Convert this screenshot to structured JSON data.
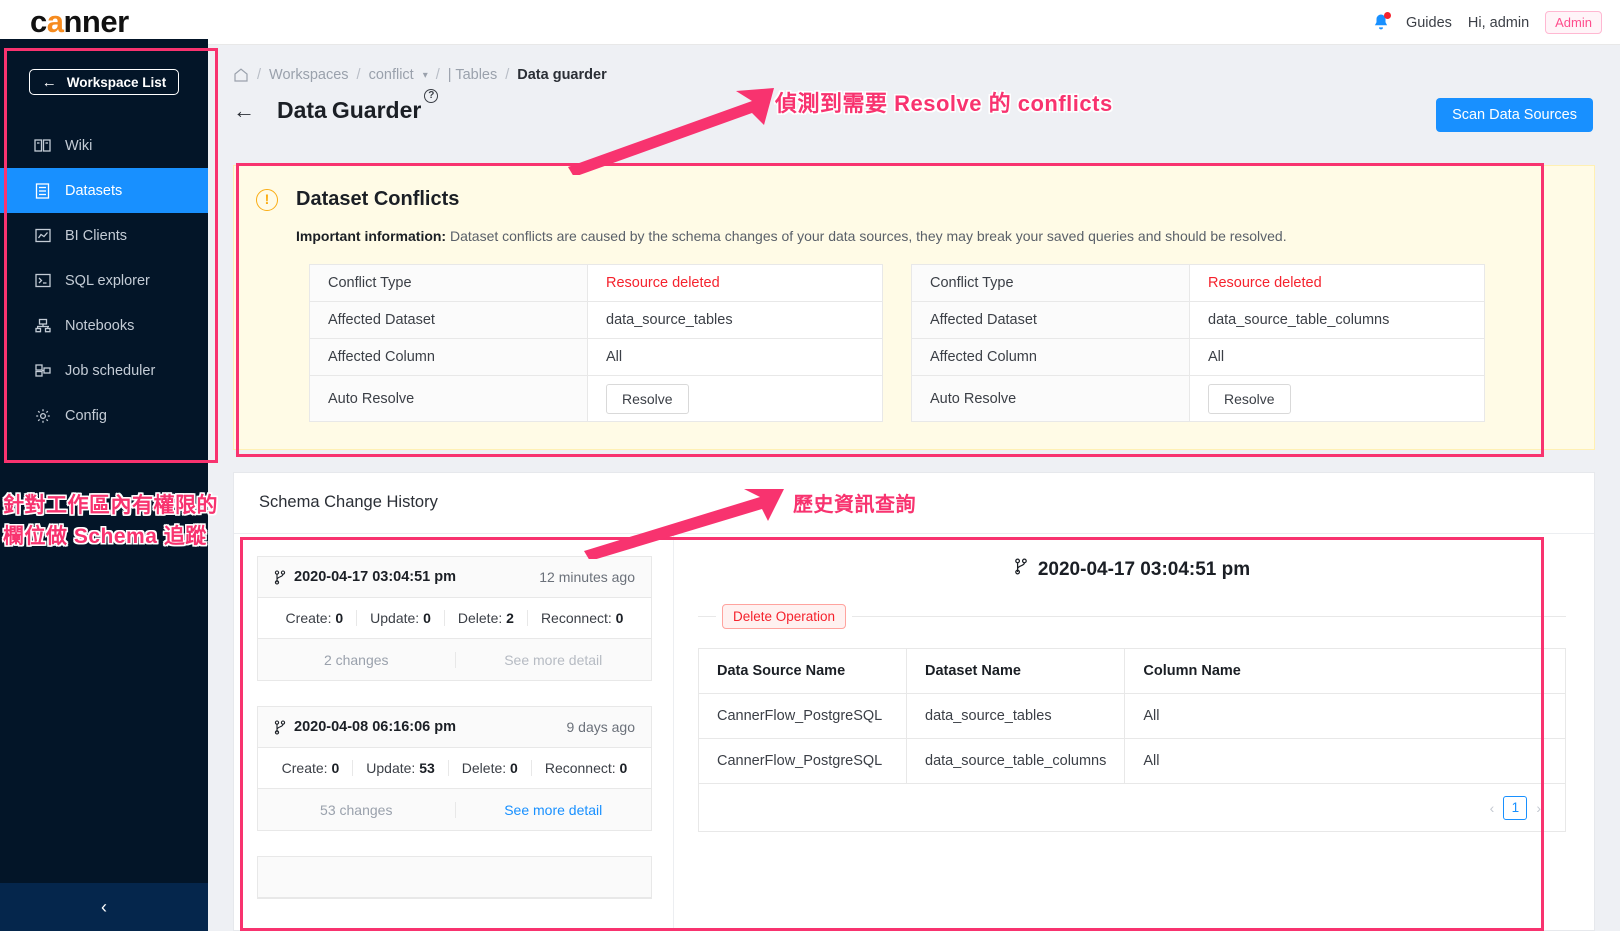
{
  "header": {
    "logo_text": "canner",
    "logo_accent_letter": "a",
    "bell_icon": "notification-bell-icon",
    "guides_label": "Guides",
    "greeting": "Hi, admin",
    "role_badge": "Admin",
    "accent_color": "#f68b1f",
    "badge_color": "#ff4d8d"
  },
  "sidebar": {
    "workspace_button": "Workspace List",
    "back_arrow": "←",
    "collapse_icon": "‹",
    "active_color": "#1890ff",
    "background": "#031528",
    "items": [
      {
        "label": "Wiki",
        "icon": "book-icon",
        "active": false
      },
      {
        "label": "Datasets",
        "icon": "database-icon",
        "active": true
      },
      {
        "label": "BI Clients",
        "icon": "chart-icon",
        "active": false
      },
      {
        "label": "SQL explorer",
        "icon": "terminal-icon",
        "active": false
      },
      {
        "label": "Notebooks",
        "icon": "notebook-icon",
        "active": false
      },
      {
        "label": "Job scheduler",
        "icon": "schedule-icon",
        "active": false
      },
      {
        "label": "Config",
        "icon": "gear-icon",
        "active": false
      }
    ]
  },
  "breadcrumb": {
    "home_icon": "home-icon",
    "workspaces": "Workspaces",
    "workspace_name": "conflict",
    "tables": "| Tables",
    "current": "Data guarder",
    "separator": "/"
  },
  "page": {
    "back_arrow": "←",
    "title_part1": "Data",
    "title_part2": "Guarder",
    "help_icon": "question-circle-icon",
    "scan_button": "Scan Data Sources"
  },
  "conflicts": {
    "warn_icon": "exclamation-circle-icon",
    "title": "Dataset Conflicts",
    "note_bold": "Important information:",
    "note_rest": " Dataset conflicts are caused by the schema changes of your data sources, they may break your saved queries and should be resolved.",
    "row_labels": [
      "Conflict Type",
      "Affected Dataset",
      "Affected Column",
      "Auto Resolve"
    ],
    "resolve_button": "Resolve",
    "cards": [
      {
        "conflict_type": "Resource deleted",
        "affected_dataset": "data_source_tables",
        "affected_column": "All"
      },
      {
        "conflict_type": "Resource deleted",
        "affected_dataset": "data_source_table_columns",
        "affected_column": "All"
      }
    ],
    "danger_color": "#f5222d",
    "panel_background": "#fffbe6"
  },
  "history": {
    "title": "Schema Change History",
    "branch_icon": "git-branch-icon",
    "cards": [
      {
        "timestamp": "2020-04-17 03:04:51 pm",
        "relative": "12 minutes ago",
        "create_label": "Create:",
        "create": "0",
        "update_label": "Update:",
        "update": "0",
        "delete_label": "Delete:",
        "delete": "2",
        "reconnect_label": "Reconnect:",
        "reconnect": "0",
        "changes": "2 changes",
        "detail_link": "See more detail",
        "detail_enabled": false
      },
      {
        "timestamp": "2020-04-08 06:16:06 pm",
        "relative": "9 days ago",
        "create_label": "Create:",
        "create": "0",
        "update_label": "Update:",
        "update": "53",
        "delete_label": "Delete:",
        "delete": "0",
        "reconnect_label": "Reconnect:",
        "reconnect": "0",
        "changes": "53 changes",
        "detail_link": "See more detail",
        "detail_enabled": true
      }
    ],
    "detail": {
      "timestamp": "2020-04-17 03:04:51 pm",
      "operation_badge": "Delete Operation",
      "columns": [
        "Data Source Name",
        "Dataset Name",
        "Column Name"
      ],
      "rows": [
        {
          "data_source": "CannerFlow_PostgreSQL",
          "dataset": "data_source_tables",
          "column": "All"
        },
        {
          "data_source": "CannerFlow_PostgreSQL",
          "dataset": "data_source_table_columns",
          "column": "All"
        }
      ],
      "pagination": {
        "prev": "‹",
        "page": "1",
        "next": "›"
      }
    }
  },
  "annotations": {
    "color": "#f8336f",
    "conflicts_note": "偵測到需要 Resolve 的 conflicts",
    "sidebar_note_line1": "針對工作區內有權限的",
    "sidebar_note_line2": "欄位做 Schema 追蹤",
    "history_note": "歷史資訊查詢"
  }
}
